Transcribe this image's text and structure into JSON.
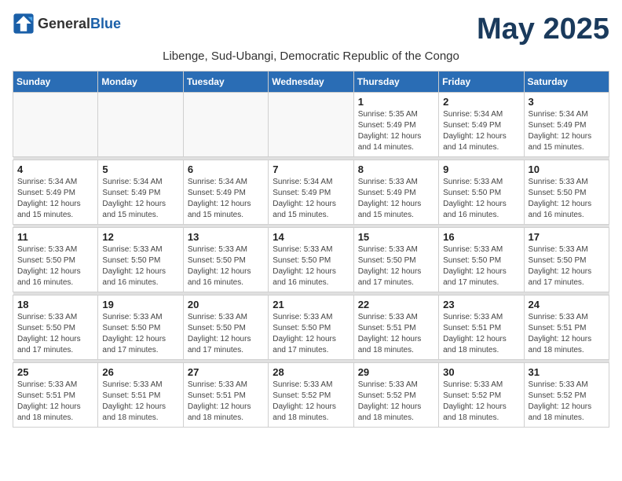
{
  "header": {
    "logo_general": "General",
    "logo_blue": "Blue",
    "month_title": "May 2025",
    "location": "Libenge, Sud-Ubangi, Democratic Republic of the Congo"
  },
  "weekdays": [
    "Sunday",
    "Monday",
    "Tuesday",
    "Wednesday",
    "Thursday",
    "Friday",
    "Saturday"
  ],
  "weeks": [
    [
      {
        "day": "",
        "info": ""
      },
      {
        "day": "",
        "info": ""
      },
      {
        "day": "",
        "info": ""
      },
      {
        "day": "",
        "info": ""
      },
      {
        "day": "1",
        "info": "Sunrise: 5:35 AM\nSunset: 5:49 PM\nDaylight: 12 hours\nand 14 minutes."
      },
      {
        "day": "2",
        "info": "Sunrise: 5:34 AM\nSunset: 5:49 PM\nDaylight: 12 hours\nand 14 minutes."
      },
      {
        "day": "3",
        "info": "Sunrise: 5:34 AM\nSunset: 5:49 PM\nDaylight: 12 hours\nand 15 minutes."
      }
    ],
    [
      {
        "day": "4",
        "info": "Sunrise: 5:34 AM\nSunset: 5:49 PM\nDaylight: 12 hours\nand 15 minutes."
      },
      {
        "day": "5",
        "info": "Sunrise: 5:34 AM\nSunset: 5:49 PM\nDaylight: 12 hours\nand 15 minutes."
      },
      {
        "day": "6",
        "info": "Sunrise: 5:34 AM\nSunset: 5:49 PM\nDaylight: 12 hours\nand 15 minutes."
      },
      {
        "day": "7",
        "info": "Sunrise: 5:34 AM\nSunset: 5:49 PM\nDaylight: 12 hours\nand 15 minutes."
      },
      {
        "day": "8",
        "info": "Sunrise: 5:33 AM\nSunset: 5:49 PM\nDaylight: 12 hours\nand 15 minutes."
      },
      {
        "day": "9",
        "info": "Sunrise: 5:33 AM\nSunset: 5:50 PM\nDaylight: 12 hours\nand 16 minutes."
      },
      {
        "day": "10",
        "info": "Sunrise: 5:33 AM\nSunset: 5:50 PM\nDaylight: 12 hours\nand 16 minutes."
      }
    ],
    [
      {
        "day": "11",
        "info": "Sunrise: 5:33 AM\nSunset: 5:50 PM\nDaylight: 12 hours\nand 16 minutes."
      },
      {
        "day": "12",
        "info": "Sunrise: 5:33 AM\nSunset: 5:50 PM\nDaylight: 12 hours\nand 16 minutes."
      },
      {
        "day": "13",
        "info": "Sunrise: 5:33 AM\nSunset: 5:50 PM\nDaylight: 12 hours\nand 16 minutes."
      },
      {
        "day": "14",
        "info": "Sunrise: 5:33 AM\nSunset: 5:50 PM\nDaylight: 12 hours\nand 16 minutes."
      },
      {
        "day": "15",
        "info": "Sunrise: 5:33 AM\nSunset: 5:50 PM\nDaylight: 12 hours\nand 17 minutes."
      },
      {
        "day": "16",
        "info": "Sunrise: 5:33 AM\nSunset: 5:50 PM\nDaylight: 12 hours\nand 17 minutes."
      },
      {
        "day": "17",
        "info": "Sunrise: 5:33 AM\nSunset: 5:50 PM\nDaylight: 12 hours\nand 17 minutes."
      }
    ],
    [
      {
        "day": "18",
        "info": "Sunrise: 5:33 AM\nSunset: 5:50 PM\nDaylight: 12 hours\nand 17 minutes."
      },
      {
        "day": "19",
        "info": "Sunrise: 5:33 AM\nSunset: 5:50 PM\nDaylight: 12 hours\nand 17 minutes."
      },
      {
        "day": "20",
        "info": "Sunrise: 5:33 AM\nSunset: 5:50 PM\nDaylight: 12 hours\nand 17 minutes."
      },
      {
        "day": "21",
        "info": "Sunrise: 5:33 AM\nSunset: 5:50 PM\nDaylight: 12 hours\nand 17 minutes."
      },
      {
        "day": "22",
        "info": "Sunrise: 5:33 AM\nSunset: 5:51 PM\nDaylight: 12 hours\nand 18 minutes."
      },
      {
        "day": "23",
        "info": "Sunrise: 5:33 AM\nSunset: 5:51 PM\nDaylight: 12 hours\nand 18 minutes."
      },
      {
        "day": "24",
        "info": "Sunrise: 5:33 AM\nSunset: 5:51 PM\nDaylight: 12 hours\nand 18 minutes."
      }
    ],
    [
      {
        "day": "25",
        "info": "Sunrise: 5:33 AM\nSunset: 5:51 PM\nDaylight: 12 hours\nand 18 minutes."
      },
      {
        "day": "26",
        "info": "Sunrise: 5:33 AM\nSunset: 5:51 PM\nDaylight: 12 hours\nand 18 minutes."
      },
      {
        "day": "27",
        "info": "Sunrise: 5:33 AM\nSunset: 5:51 PM\nDaylight: 12 hours\nand 18 minutes."
      },
      {
        "day": "28",
        "info": "Sunrise: 5:33 AM\nSunset: 5:52 PM\nDaylight: 12 hours\nand 18 minutes."
      },
      {
        "day": "29",
        "info": "Sunrise: 5:33 AM\nSunset: 5:52 PM\nDaylight: 12 hours\nand 18 minutes."
      },
      {
        "day": "30",
        "info": "Sunrise: 5:33 AM\nSunset: 5:52 PM\nDaylight: 12 hours\nand 18 minutes."
      },
      {
        "day": "31",
        "info": "Sunrise: 5:33 AM\nSunset: 5:52 PM\nDaylight: 12 hours\nand 18 minutes."
      }
    ]
  ]
}
